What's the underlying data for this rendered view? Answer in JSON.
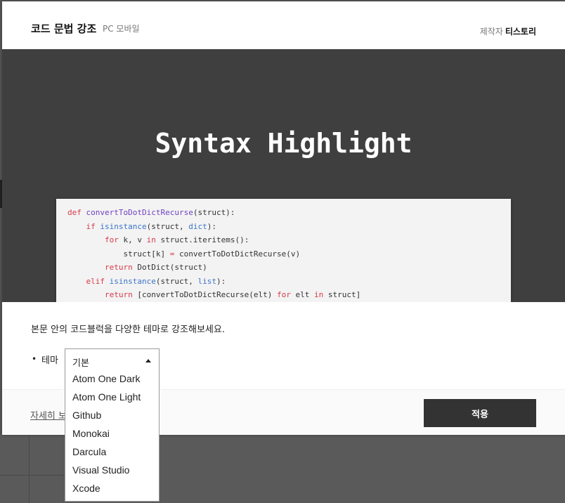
{
  "header": {
    "title": "코드 문법 강조",
    "platforms": "PC 모바일",
    "maker_label": "제작자",
    "maker_name": "티스토리"
  },
  "preview": {
    "hero_title": "Syntax Highlight",
    "code_lines": [
      "def convertToDotDictRecurse(struct):",
      "    if isinstance(struct, dict):",
      "        for k, v in struct.iteritems():",
      "            struct[k] = convertToDotDictRecurse(v)",
      "        return DotDict(struct)",
      "    elif isinstance(struct, list):",
      "        return [convertToDotDictRecurse(elt) for elt in struct]"
    ]
  },
  "body": {
    "description": "본문 안의 코드블럭을 다양한 테마로 강조해보세요.",
    "bullet": "•",
    "theme_label": "테마"
  },
  "footer": {
    "more_link": "자세히 보",
    "apply_label": "적용"
  },
  "theme_dropdown": {
    "selected": "기본",
    "options": [
      "Atom One Dark",
      "Atom One Light",
      "Github",
      "Monokai",
      "Darcula",
      "Visual Studio",
      "Xcode"
    ]
  },
  "colors": {
    "keyword": "#d73a49",
    "function": "#6f42c1",
    "builtin": "#3b74c9",
    "preview_bg": "#3f3f3f",
    "button_bg": "#333333"
  }
}
